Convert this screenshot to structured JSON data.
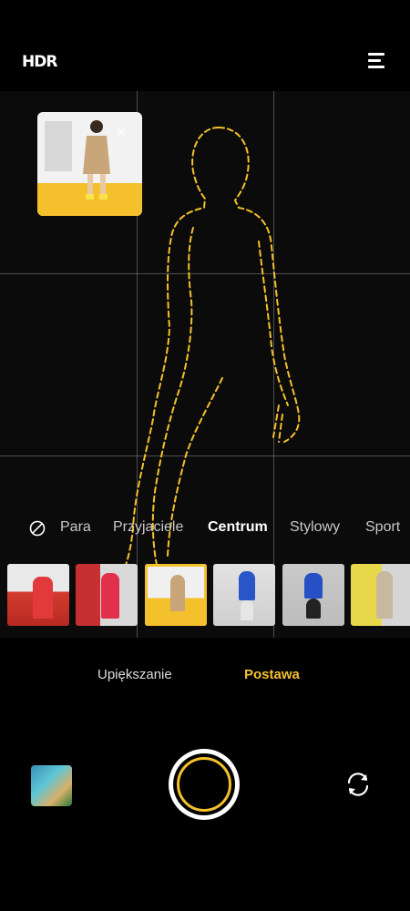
{
  "top_bar": {
    "hdr_label": "HDR",
    "menu_icon": "menu-icon"
  },
  "viewfinder": {
    "grid": "3x3",
    "pose_preview_close_icon": "close-icon",
    "silhouette_color": "#f4c02c"
  },
  "pose_modes": {
    "none_icon": "no-filter-icon",
    "items": [
      {
        "label": "Para"
      },
      {
        "label": "Przyjaciele"
      },
      {
        "label": "Centrum"
      },
      {
        "label": "Stylowy"
      },
      {
        "label": "Sport"
      }
    ],
    "selected": "Centrum"
  },
  "pose_thumbnails": {
    "count": 6,
    "selected_index": 2
  },
  "bottom_tabs": {
    "items": [
      {
        "label": "Upiększanie"
      },
      {
        "label": "Postawa"
      }
    ],
    "active": "Postawa"
  },
  "controls": {
    "gallery_icon": "gallery-thumbnail",
    "shutter_icon": "shutter-button",
    "switch_icon": "switch-camera-icon"
  },
  "colors": {
    "accent": "#f4c02c",
    "background": "#000000"
  }
}
